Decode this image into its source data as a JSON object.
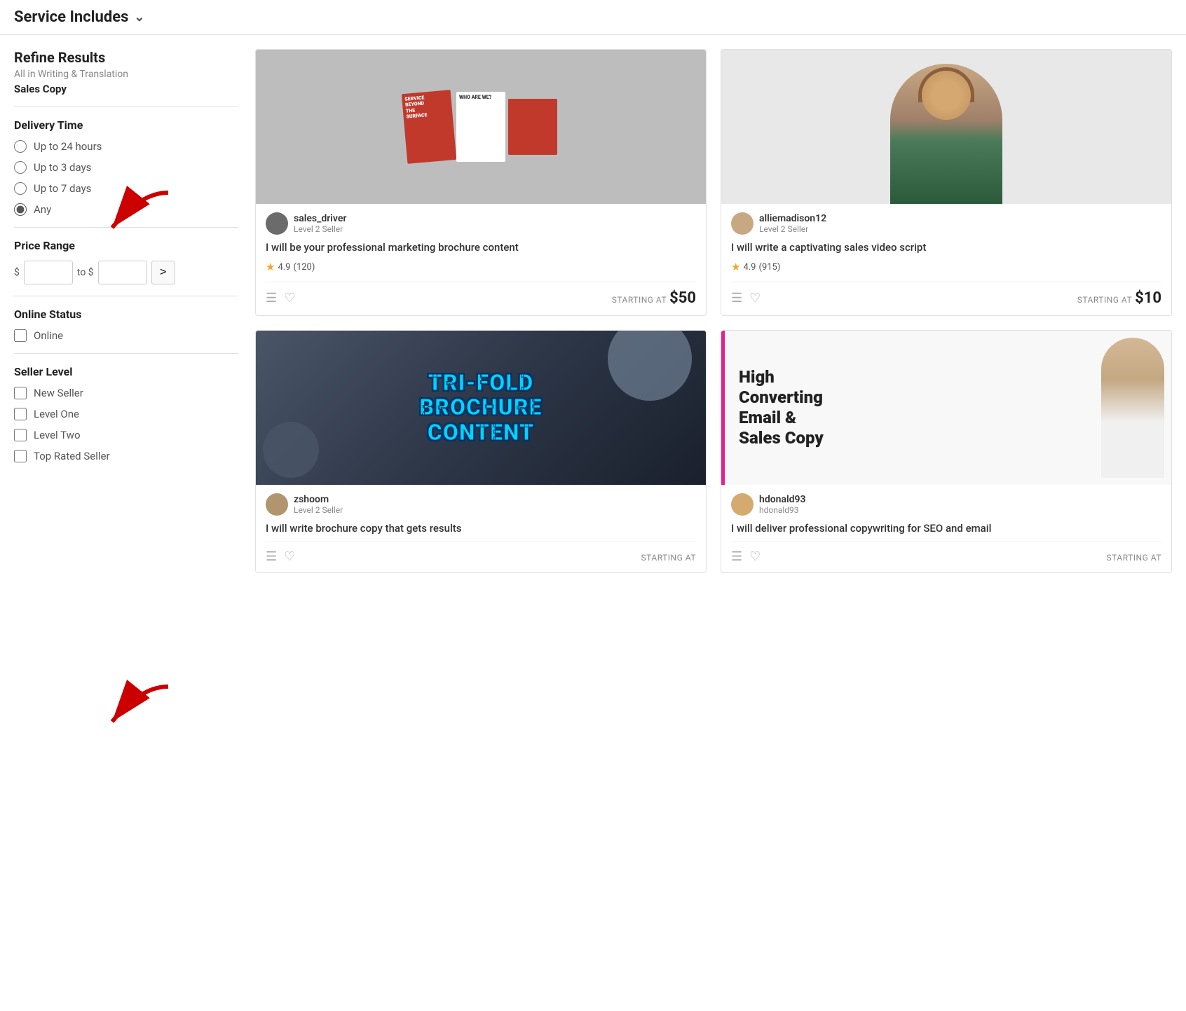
{
  "header": {
    "title": "Service Includes",
    "chevron": "chevron-down"
  },
  "sidebar": {
    "section_title": "Refine Results",
    "subtitle": "All in Writing & Translation",
    "category": "Sales Copy",
    "delivery": {
      "title": "Delivery Time",
      "options": [
        {
          "label": "Up to 24 hours",
          "value": "24h",
          "checked": false
        },
        {
          "label": "Up to 3 days",
          "value": "3d",
          "checked": false
        },
        {
          "label": "Up to 7 days",
          "value": "7d",
          "checked": false
        },
        {
          "label": "Any",
          "value": "any",
          "checked": true
        }
      ]
    },
    "price_range": {
      "title": "Price Range",
      "from_label": "$",
      "to_label": "to $",
      "from_placeholder": "",
      "to_placeholder": "",
      "arrow_label": ">"
    },
    "online_status": {
      "title": "Online Status",
      "options": [
        {
          "label": "Online",
          "checked": false
        }
      ]
    },
    "seller_level": {
      "title": "Seller Level",
      "options": [
        {
          "label": "New Seller",
          "checked": false
        },
        {
          "label": "Level One",
          "checked": false
        },
        {
          "label": "Level Two",
          "checked": false
        },
        {
          "label": "Top Rated Seller",
          "checked": false
        }
      ]
    }
  },
  "cards": [
    {
      "id": "card1",
      "seller_name": "sales_driver",
      "seller_level": "Level 2 Seller",
      "title": "I will be your professional marketing brochure content",
      "rating": "4.9",
      "reviews": "120",
      "starting_at": "STARTING AT",
      "price": "$50",
      "image_type": "brochure"
    },
    {
      "id": "card2",
      "seller_name": "alliemadison12",
      "seller_level": "Level 2 Seller",
      "title": "I will write a captivating sales video script",
      "rating": "4.9",
      "reviews": "915",
      "starting_at": "STARTING AT",
      "price": "$10",
      "image_type": "portrait"
    },
    {
      "id": "card3",
      "seller_name": "zshoom",
      "seller_level": "Level 2 Seller",
      "title": "I will write brochure copy that gets results",
      "rating": null,
      "reviews": null,
      "starting_at": "STARTING AT",
      "price": null,
      "image_type": "trifold",
      "trifold_text": "TRI-FOLD\nBROCHURE\nCONTENT"
    },
    {
      "id": "card4",
      "seller_name": "hdonald93",
      "seller_level": "hdonald93",
      "title": "I will deliver professional copywriting for SEO and email",
      "rating": null,
      "reviews": null,
      "starting_at": "STARTING AT",
      "price": null,
      "image_type": "emailcopy",
      "emailcopy_heading": "High\nConverting\nEmail &\nSales Copy"
    }
  ],
  "arrows": {
    "arrow1_label": "arrow pointing to Up to 3 days",
    "arrow2_label": "arrow pointing to Level One"
  }
}
